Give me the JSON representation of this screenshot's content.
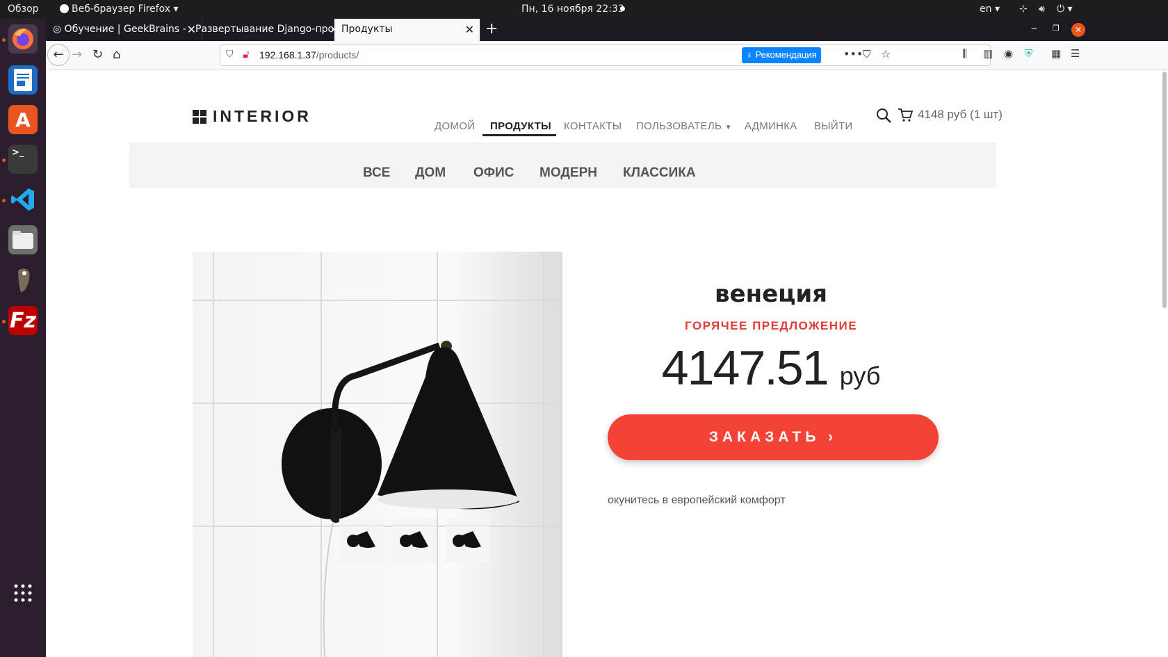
{
  "system": {
    "activities": "Обзор",
    "app_menu": "Веб-браузер Firefox",
    "clock": "Пн, 16 ноября  22:33",
    "lang": "en"
  },
  "browser": {
    "tabs": [
      {
        "label": "Обучение | GeekBrains -"
      },
      {
        "label": "Развертывание Django-про"
      },
      {
        "label": "Продукты"
      }
    ],
    "url_host": "192.168.1.37",
    "url_path": "/products/",
    "recommend": "Рекомендация"
  },
  "site": {
    "logo": "INTERIOR",
    "nav": [
      {
        "label": "ДОМОЙ"
      },
      {
        "label": "ПРОДУКТЫ"
      },
      {
        "label": "КОНТАКТЫ"
      },
      {
        "label": "ПОЛЬЗОВАТЕЛЬ"
      },
      {
        "label": "АДМИНКА"
      },
      {
        "label": "ВЫЙТИ"
      }
    ],
    "cart": "4148 руб (1 шт)",
    "categories": [
      {
        "label": "ВСЕ"
      },
      {
        "label": "ДОМ"
      },
      {
        "label": "ОФИС"
      },
      {
        "label": "МОДЕРН"
      },
      {
        "label": "КЛАССИКА"
      }
    ],
    "product": {
      "title": "венеция",
      "badge": "ГОРЯЧЕЕ ПРЕДЛОЖЕНИЕ",
      "price": "4147.51",
      "currency": "руб",
      "order_label": "ЗАКАЗАТЬ",
      "description": "окунитесь в европейский комфорт"
    }
  },
  "colors": {
    "accent": "#f44336",
    "dock": "#2c1f2d"
  }
}
